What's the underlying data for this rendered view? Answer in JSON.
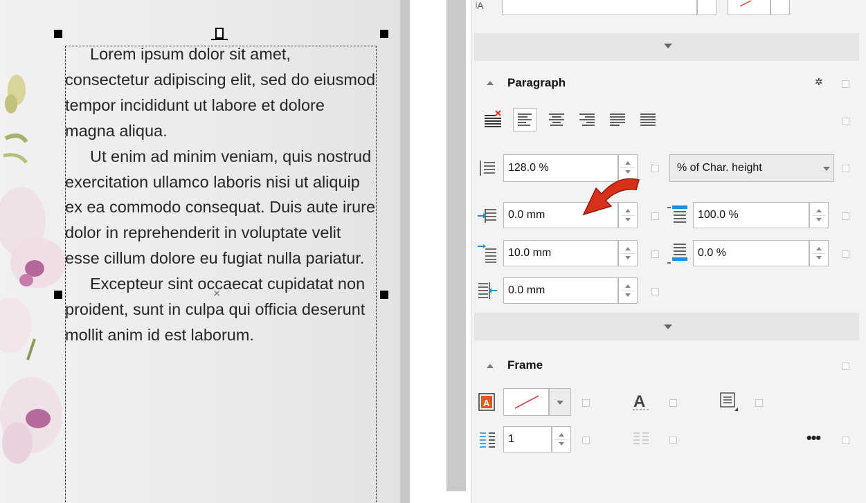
{
  "document": {
    "paragraphs": [
      "Lorem ipsum dolor sit amet, consectetur adipiscing elit, sed do eiusmod tempor incididunt ut labore et dolore magna aliqua.",
      "Ut enim ad minim veniam, quis nostrud exercitation ullamco laboris nisi ut aliquip ex ea commodo consequat. Duis aute irure dolor in reprehenderit in voluptate velit esse cillum dolore eu fugiat nulla pariatur.",
      "Excepteur sint occaecat cupidatat non proident, sunt in culpa qui officia deserunt mollit anim id est laborum."
    ]
  },
  "paragraph_section": {
    "title": "Paragraph",
    "line_spacing": {
      "value": "128.0 %",
      "unit_option": "% of Char. height"
    },
    "first_line_indent": "0.0 mm",
    "before_paragraph": "100.0 %",
    "left_indent": "10.0 mm",
    "after_paragraph": "0.0 %",
    "right_indent": "0.0 mm"
  },
  "frame_section": {
    "title": "Frame",
    "columns": "1"
  },
  "colors": {
    "accent_blue": "#1e8fe0",
    "arrow_red": "#d9301a",
    "frame_icon_orange": "#e05a1a"
  }
}
